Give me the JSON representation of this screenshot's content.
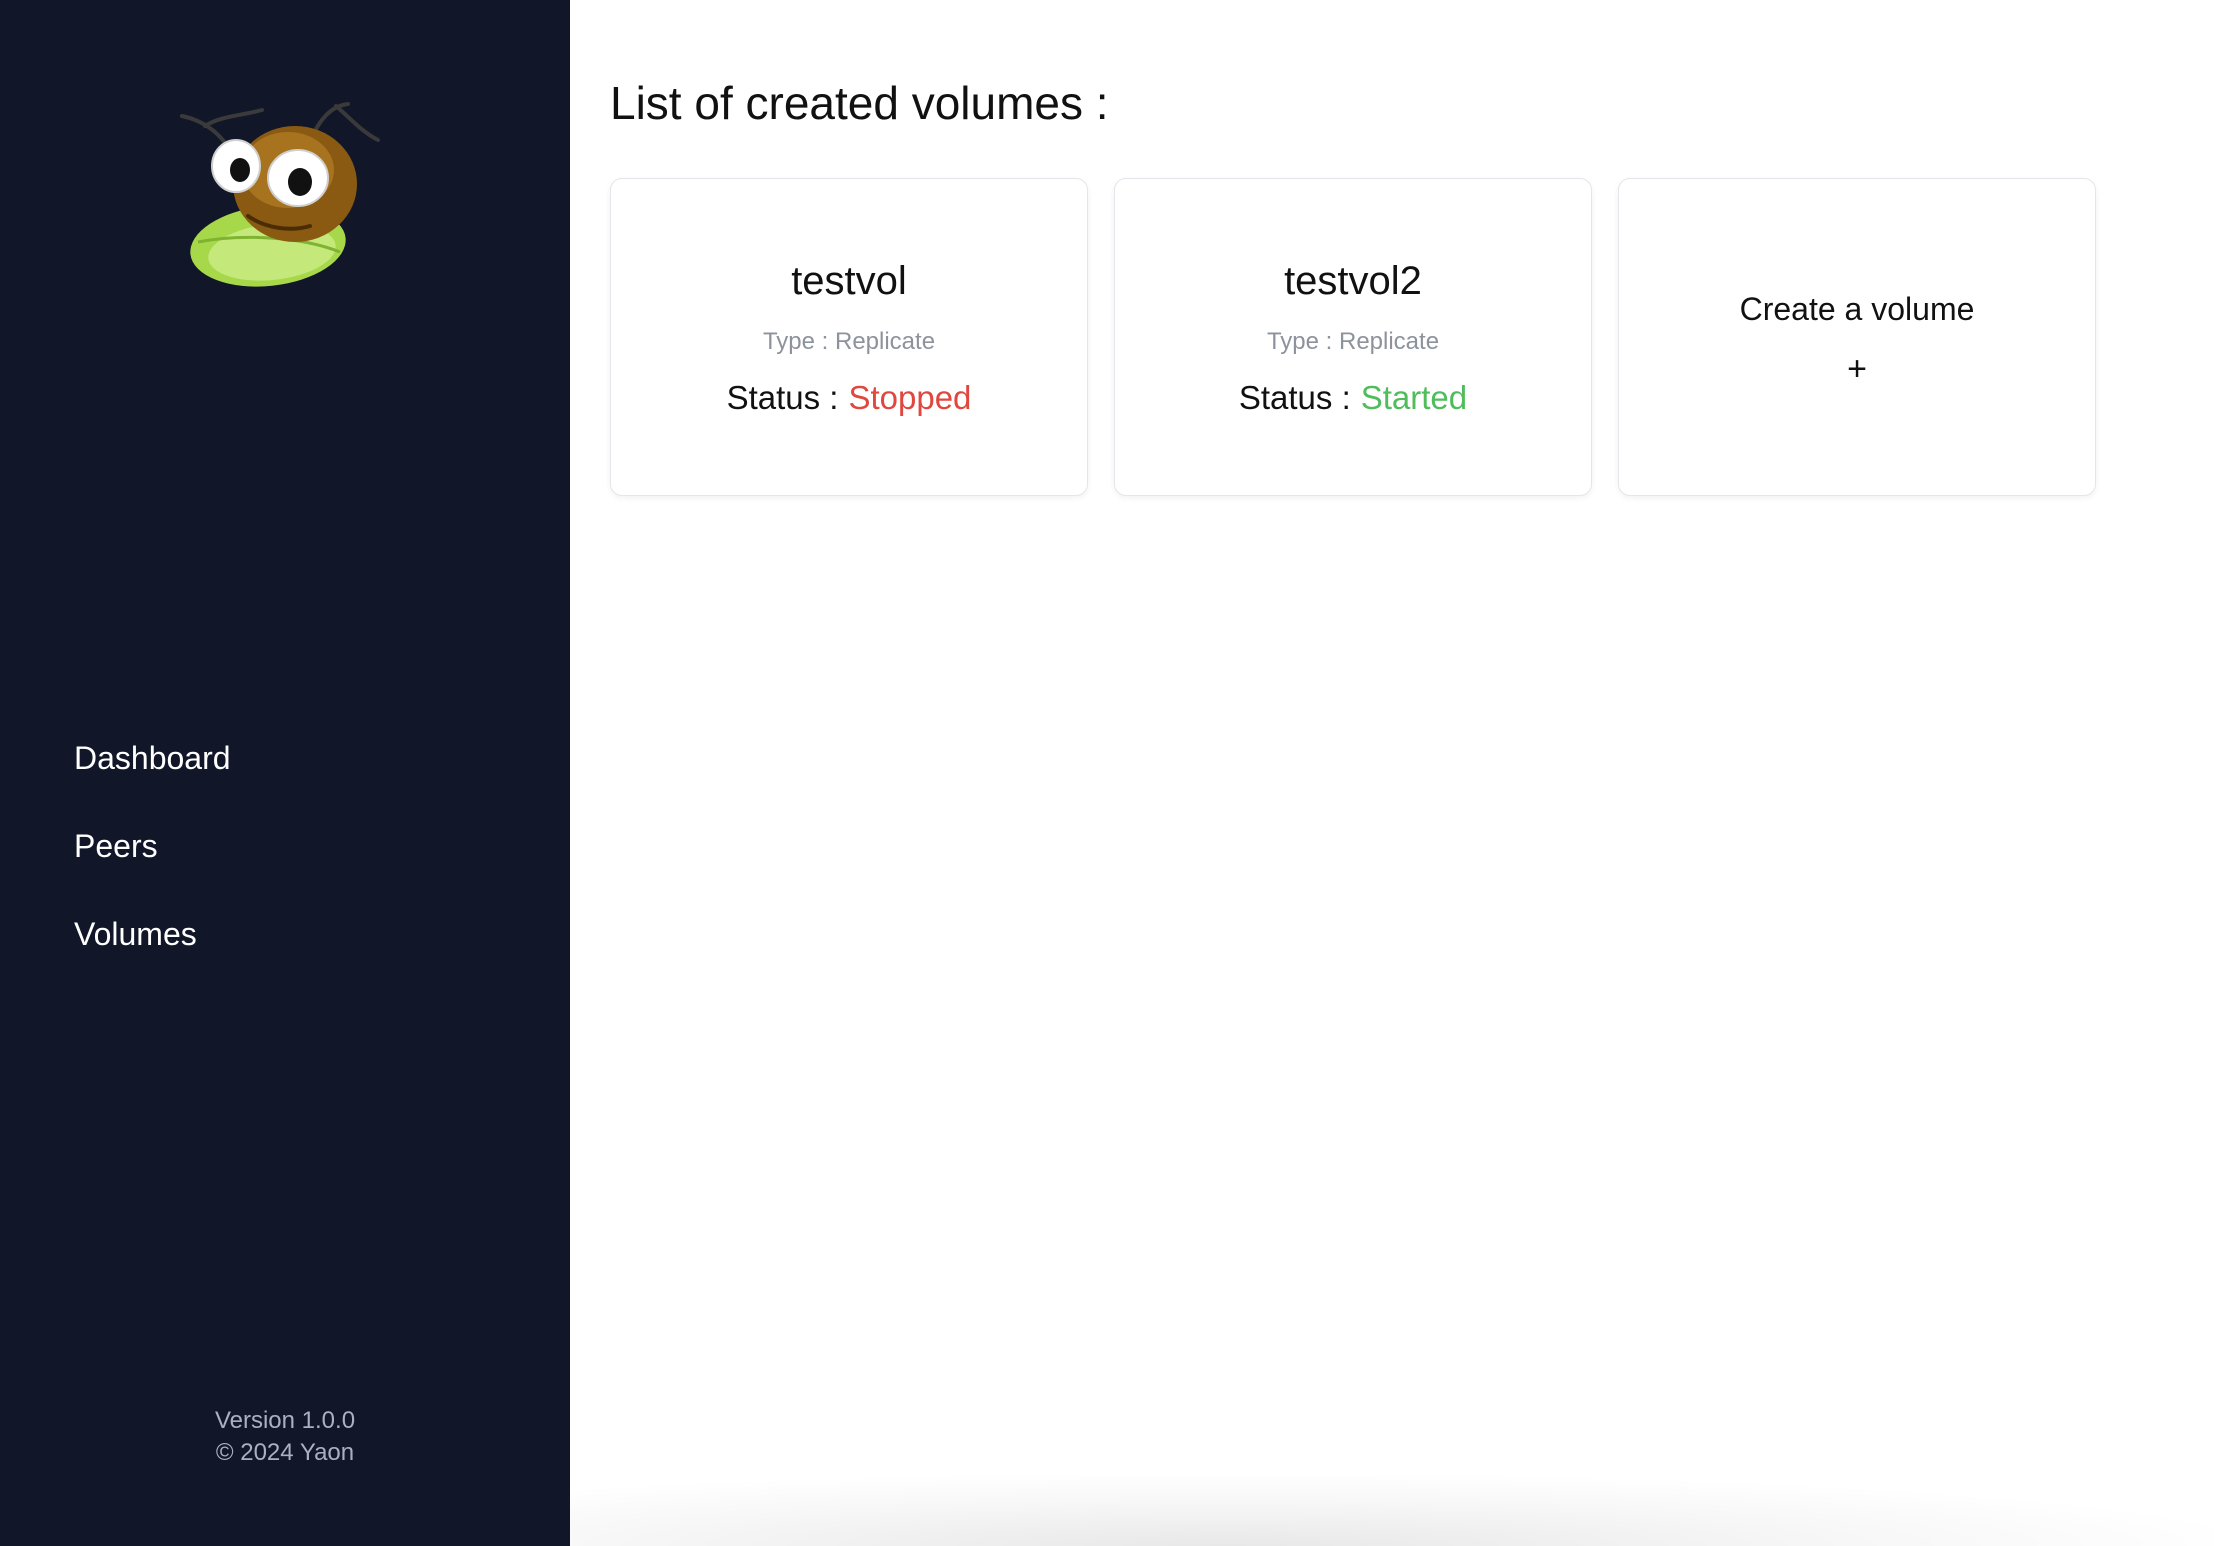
{
  "sidebar": {
    "logo": "ant-on-leaf-logo",
    "nav": [
      {
        "label": "Dashboard"
      },
      {
        "label": "Peers"
      },
      {
        "label": "Volumes"
      }
    ],
    "footer": {
      "version": "Version 1.0.0",
      "copyright": "© 2024 Yaon"
    },
    "background": "#111729"
  },
  "main": {
    "title": "List of created volumes :",
    "volumes": [
      {
        "name": "testvol",
        "type": "Type : Replicate",
        "status_label": "Status :",
        "status": "Stopped",
        "status_color": "#e0473e"
      },
      {
        "name": "testvol2",
        "type": "Type : Replicate",
        "status_label": "Status :",
        "status": "Started",
        "status_color": "#4fbd5b"
      }
    ],
    "create_card": {
      "label": "Create a volume",
      "plus": "+"
    }
  }
}
